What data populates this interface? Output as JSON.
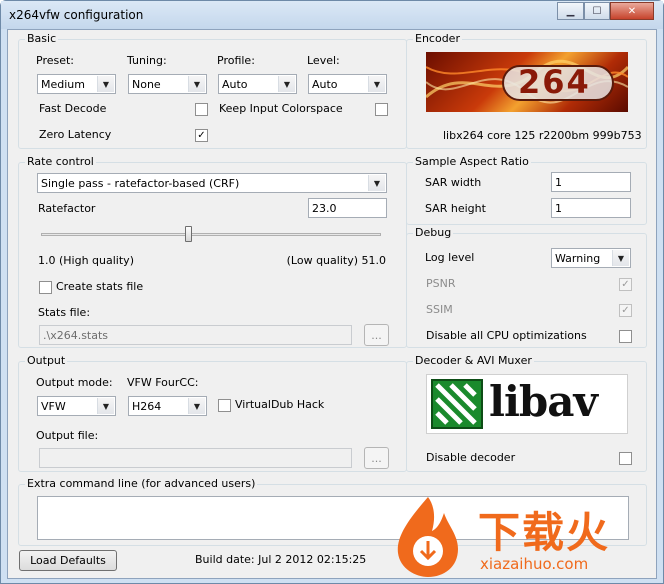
{
  "window": {
    "title": "x264vfw configuration"
  },
  "basic": {
    "group_title": "Basic",
    "preset_label": "Preset:",
    "preset_value": "Medium",
    "tuning_label": "Tuning:",
    "tuning_value": "None",
    "profile_label": "Profile:",
    "profile_value": "Auto",
    "level_label": "Level:",
    "level_value": "Auto",
    "fast_decode_label": "Fast Decode",
    "fast_decode_checked": false,
    "keep_colorspace_label": "Keep Input Colorspace",
    "keep_colorspace_checked": false,
    "zero_latency_label": "Zero Latency",
    "zero_latency_checked": true
  },
  "encoder": {
    "group_title": "Encoder",
    "logo_text": "264",
    "version": "libx264 core 125 r2200bm 999b753"
  },
  "rate_control": {
    "group_title": "Rate control",
    "mode_value": "Single pass - ratefactor-based (CRF)",
    "ratefactor_label": "Ratefactor",
    "ratefactor_value": "23.0",
    "slider_fraction": 0.435,
    "min_label": "1.0 (High quality)",
    "max_label": "(Low quality) 51.0",
    "create_stats_label": "Create stats file",
    "stats_file_label": "Stats file:",
    "stats_file_value": ".\\x264.stats",
    "browse_label": "..."
  },
  "sar": {
    "group_title": "Sample Aspect Ratio",
    "width_label": "SAR width",
    "width_value": "1",
    "height_label": "SAR height",
    "height_value": "1"
  },
  "debug": {
    "group_title": "Debug",
    "log_level_label": "Log level",
    "log_level_value": "Warning",
    "psnr_label": "PSNR",
    "psnr_checked": true,
    "ssim_label": "SSIM",
    "ssim_checked": true,
    "disable_cpu_label": "Disable all CPU optimizations",
    "disable_cpu_checked": false
  },
  "output": {
    "group_title": "Output",
    "mode_label": "Output mode:",
    "mode_value": "VFW",
    "fourcc_label": "VFW FourCC:",
    "fourcc_value": "H264",
    "vdub_label": "VirtualDub Hack",
    "file_label": "Output file:",
    "browse_label": "..."
  },
  "decoder": {
    "group_title": "Decoder & AVI Muxer",
    "logo_text": "libav",
    "disable_label": "Disable decoder"
  },
  "extra": {
    "group_title": "Extra command line (for advanced users)"
  },
  "footer": {
    "load_defaults_label": "Load Defaults",
    "build_date": "Build date: Jul  2 2012 02:15:25"
  },
  "watermark": {
    "text_cn": "下载火",
    "text_url": "xiazaihuo.com"
  },
  "colors": {
    "titlebar": "#cfe0f2",
    "libav_green": "#1a8a2c",
    "x264_orange": "#d9541c"
  }
}
